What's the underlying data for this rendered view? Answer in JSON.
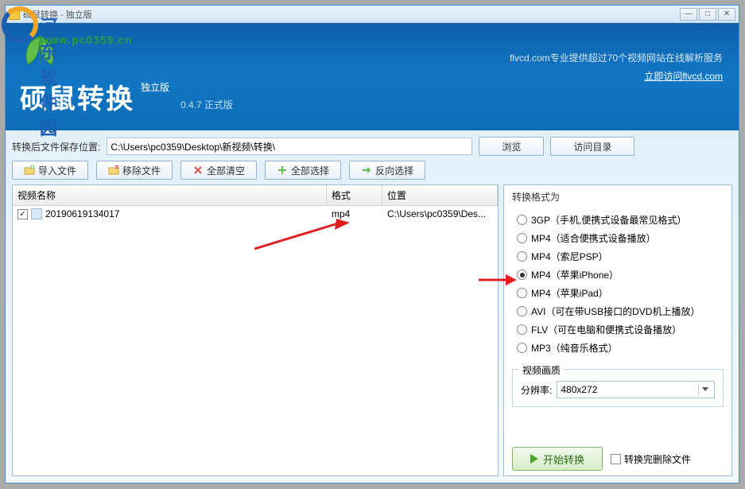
{
  "titlebar": {
    "text": "硕鼠转换 - 独立版"
  },
  "win": {
    "min": "—",
    "max": "□",
    "close": "✕"
  },
  "header": {
    "title": "硕鼠转换",
    "edition": "独立版",
    "version": "0.4.7 正式版",
    "promo": "flvcd.com专业提供超过70个视频网站在线解析服务",
    "link": "立即访问flvcd.com"
  },
  "path": {
    "label": "转换后文件保存位置:",
    "value": "C:\\Users\\pc0359\\Desktop\\新视频\\转换\\",
    "browse": "浏览",
    "open_dir": "访问目录"
  },
  "toolbar": {
    "import": "导入文件",
    "remove": "移除文件",
    "clear": "全部清空",
    "select_all": "全部选择",
    "invert": "反向选择"
  },
  "table": {
    "head": {
      "name": "视频名称",
      "format": "格式",
      "location": "位置"
    },
    "rows": [
      {
        "checked": true,
        "name": "20190619134017",
        "format": "mp4",
        "location": "C:\\Users\\pc0359\\Des..."
      }
    ]
  },
  "formats": {
    "title": "转换格式为",
    "options": [
      {
        "label": "3GP（手机,便携式设备最常见格式）",
        "checked": false
      },
      {
        "label": "MP4（适合便携式设备播放）",
        "checked": false
      },
      {
        "label": "MP4（索尼PSP）",
        "checked": false
      },
      {
        "label": "MP4（苹果iPhone）",
        "checked": true
      },
      {
        "label": "MP4（苹果iPad）",
        "checked": false
      },
      {
        "label": "AVI（可在带USB接口的DVD机上播放）",
        "checked": false
      },
      {
        "label": "FLV（可在电脑和便携式设备播放）",
        "checked": false
      },
      {
        "label": "MP3（纯音乐格式）",
        "checked": false
      }
    ]
  },
  "quality": {
    "title": "视频画质",
    "res_label": "分辨率:",
    "res_value": "480x272"
  },
  "footer": {
    "start": "开始转换",
    "delete_after": "转换完删除文件"
  },
  "watermark": {
    "name": "河东软件园",
    "url": "www.pc0359.cn"
  }
}
